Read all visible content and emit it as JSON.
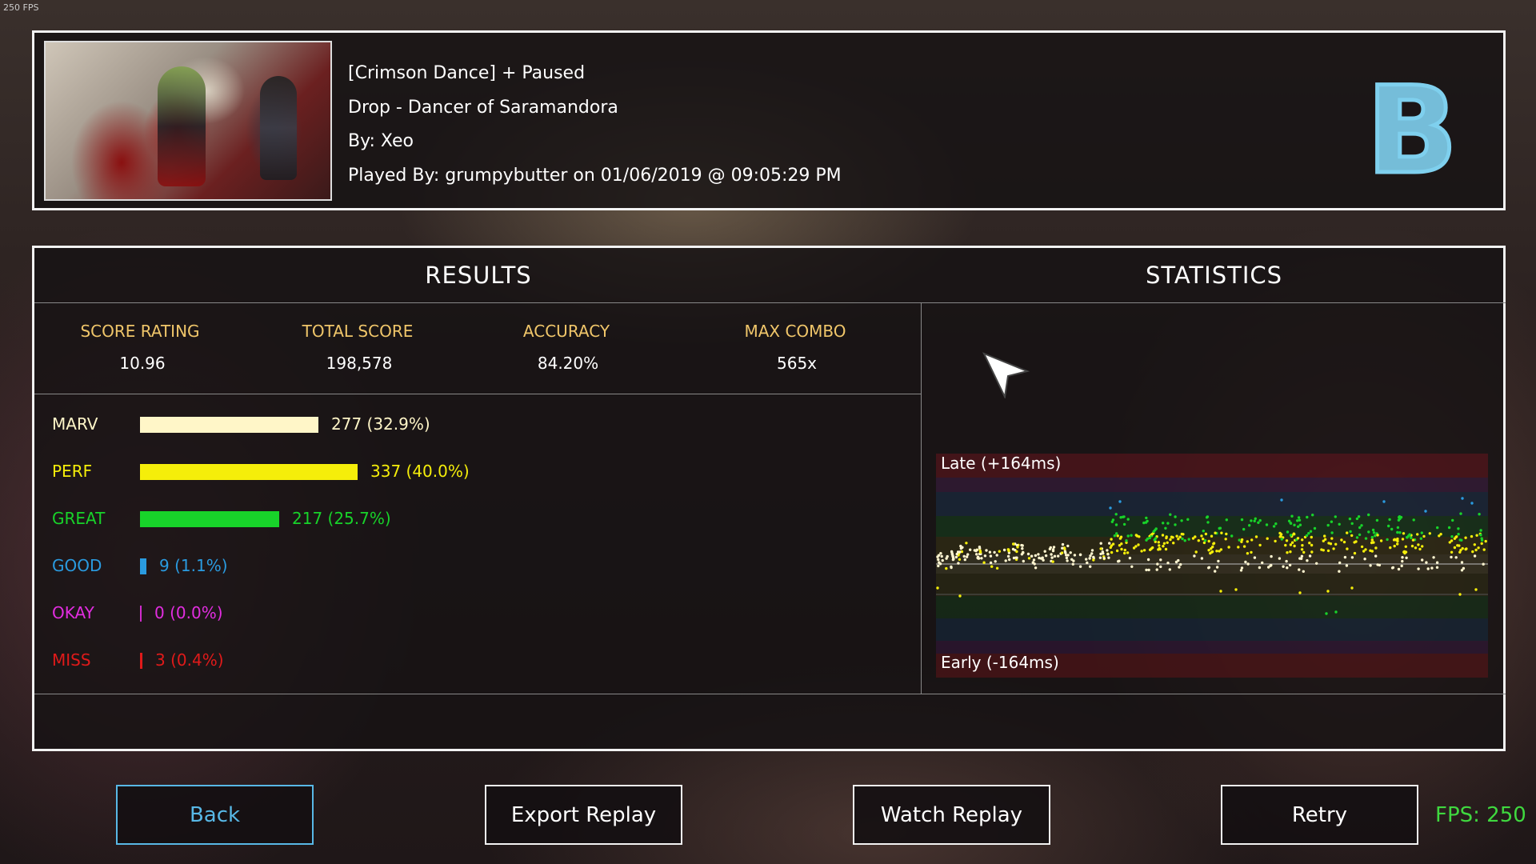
{
  "overlay": {
    "fps_small": "250 FPS",
    "fps": "FPS: 250"
  },
  "header": {
    "title": "[Crimson Dance] + Paused",
    "song": "Drop - Dancer of Saramandora",
    "creator": "By: Xeo",
    "played_by": "Played By: grumpybutter on 01/06/2019 @ 09:05:29 PM",
    "grade": "B",
    "grade_color": "#7fd0ee"
  },
  "results": {
    "heading": "RESULTS",
    "stats": [
      {
        "label": "SCORE RATING",
        "value": "10.96"
      },
      {
        "label": "TOTAL SCORE",
        "value": "198,578"
      },
      {
        "label": "ACCURACY",
        "value": "84.20%"
      },
      {
        "label": "MAX COMBO",
        "value": "565x"
      }
    ],
    "judgements": [
      {
        "name": "MARV",
        "text": "277 (32.9%)",
        "fraction": 0.82,
        "color": "#fff6c8"
      },
      {
        "name": "PERF",
        "text": "337 (40.0%)",
        "fraction": 1.0,
        "color": "#f5ee0a"
      },
      {
        "name": "GREAT",
        "text": "217 (25.7%)",
        "fraction": 0.64,
        "color": "#18d32a"
      },
      {
        "name": "GOOD",
        "text": "9 (1.1%)",
        "fraction": 0.03,
        "color": "#2a9be0"
      },
      {
        "name": "OKAY",
        "text": "0 (0.0%)",
        "fraction": 0.0,
        "color": "#e22de0"
      },
      {
        "name": "MISS",
        "text": "3 (0.4%)",
        "fraction": 0.01,
        "color": "#e01a1a"
      }
    ]
  },
  "statistics": {
    "heading": "STATISTICS",
    "late_label": "Late (+164ms)",
    "early_label": "Early (-164ms)"
  },
  "buttons": {
    "back": "Back",
    "export_replay": "Export Replay",
    "watch_replay": "Watch Replay",
    "retry": "Retry"
  }
}
